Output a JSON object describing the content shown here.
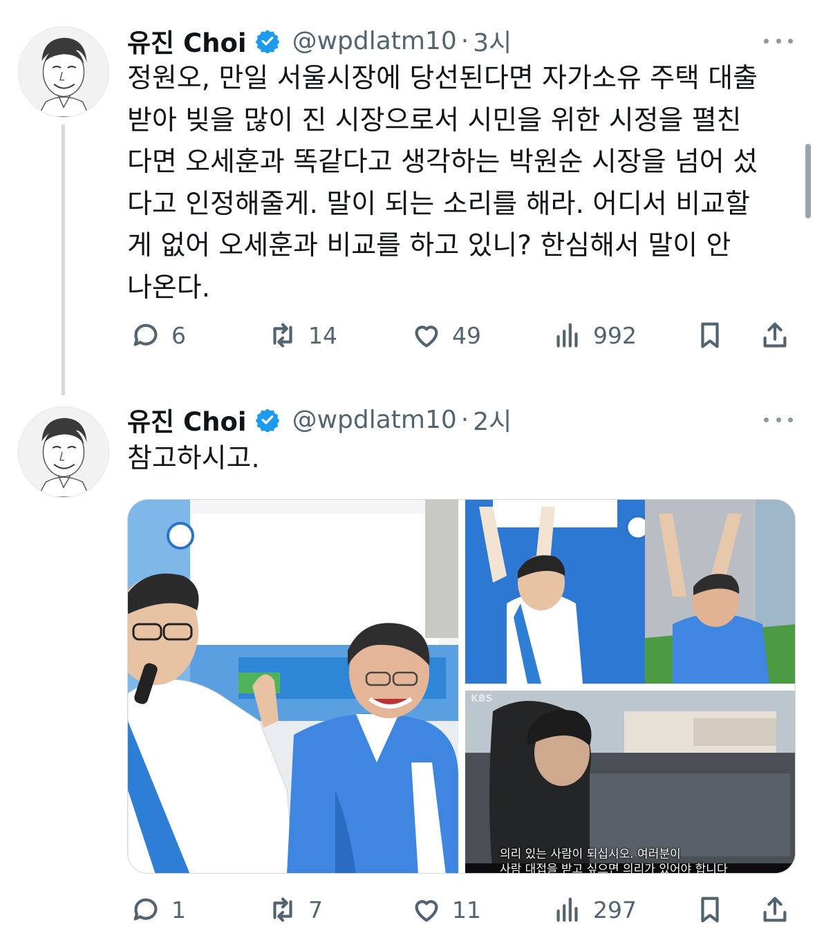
{
  "tweets": [
    {
      "name": "유진 Choi",
      "handle": "@wpdlatm10",
      "separator": "·",
      "time": "3시",
      "text": "정원오, 만일 서울시장에 당선된다면 자가소유 주택 대출\n받아 빚을 많이 진 시장으로서 시민을 위한 시정을 펼친\n다면 오세훈과 똑같다고 생각하는 박원순 시장을 넘어 섰\n다고 인정해줄게. 말이 되는 소리를 해라. 어디서 비교할\n게 없어 오세훈과 비교를 하고 있니? 한심해서 말이 안\n나온다.",
      "replies": "6",
      "reposts": "14",
      "likes": "49",
      "views": "992"
    },
    {
      "name": "유진 Choi",
      "handle": "@wpdlatm10",
      "separator": "·",
      "time": "2시",
      "text": "참고하시고.",
      "replies": "1",
      "reposts": "7",
      "likes": "11",
      "views": "297",
      "media": {
        "broadcaster_mark": "KBS",
        "subtitle_line1": "의리 있는 사람이 되십시오. 여러분이",
        "subtitle_line2": "사람 대접을 받고 싶으면 의리가 있어야 합니다"
      }
    }
  ],
  "icons": {
    "verified": "verified-badge-icon",
    "more": "more-dots-icon",
    "reply": "reply-bubble-icon",
    "repost": "repost-arrows-icon",
    "like": "heart-icon",
    "views": "bar-chart-icon",
    "bookmark": "bookmark-icon",
    "share": "share-upload-icon"
  },
  "colors": {
    "text": "#0f1419",
    "secondary": "#536471",
    "verified": "#1d9bf0",
    "thread_line": "#cfd9de",
    "campaign_blue": "#1e6fd6"
  }
}
